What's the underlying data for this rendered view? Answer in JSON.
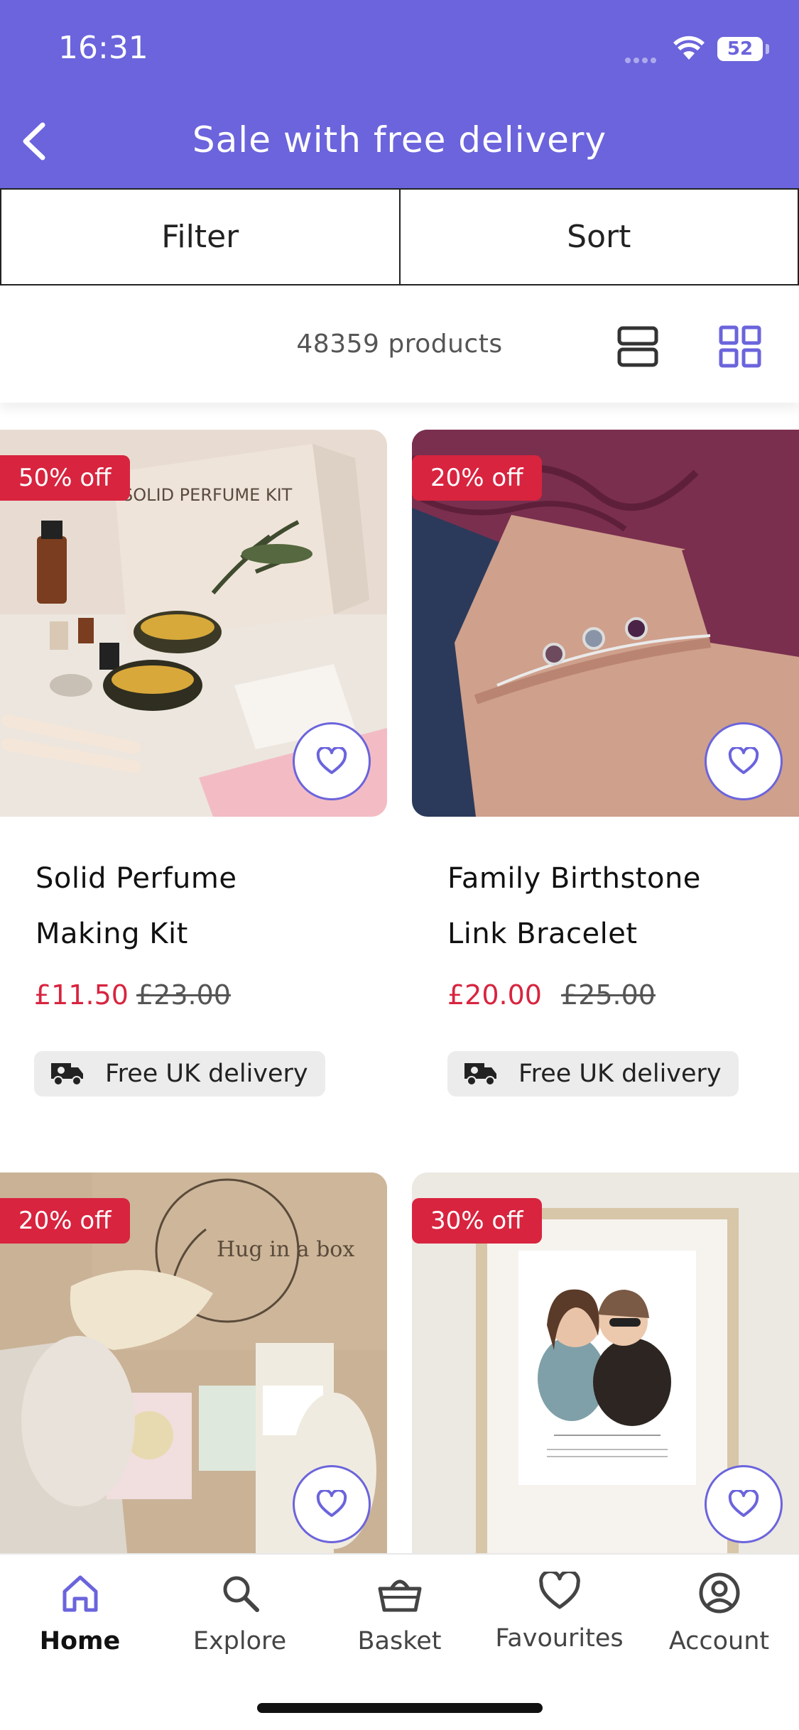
{
  "status_bar": {
    "time": "16:31",
    "battery": "52"
  },
  "header": {
    "title": "Sale with free delivery"
  },
  "toolbar": {
    "filter_label": "Filter",
    "sort_label": "Sort"
  },
  "results": {
    "count_text": "48359 products"
  },
  "products": [
    {
      "badge": "50% off",
      "name_line1": "Solid Perfume",
      "name_line2": "Making Kit",
      "price": "£11.50",
      "was_price": "£23.00",
      "delivery": "Free UK delivery"
    },
    {
      "badge": "20% off",
      "name_line1": "Family Birthstone",
      "name_line2": "Link Bracelet",
      "price": "£20.00",
      "was_price": "£25.00",
      "delivery": "Free UK delivery"
    },
    {
      "badge": "20% off"
    },
    {
      "badge": "30% off"
    }
  ],
  "image_text": {
    "perfume_box": "SOLID PERFUME KIT",
    "hug_box": "Hug in a box"
  },
  "nav": {
    "items": [
      {
        "label": "Home",
        "icon": "home-icon",
        "active": true
      },
      {
        "label": "Explore",
        "icon": "search-icon"
      },
      {
        "label": "Basket",
        "icon": "basket-icon"
      },
      {
        "label": "Favourites",
        "icon": "heart-icon"
      },
      {
        "label": "Account",
        "icon": "account-icon"
      }
    ]
  },
  "colors": {
    "brand": "#6b64dc",
    "sale": "#d8243f",
    "chip_bg": "#ececec"
  }
}
